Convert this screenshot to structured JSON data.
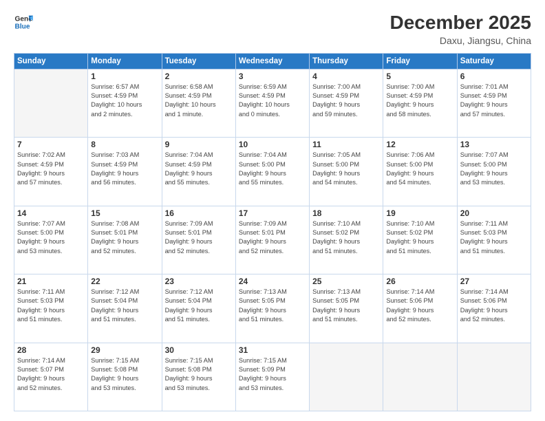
{
  "header": {
    "logo": {
      "line1": "General",
      "line2": "Blue"
    },
    "title": "December 2025",
    "location": "Daxu, Jiangsu, China"
  },
  "days_of_week": [
    "Sunday",
    "Monday",
    "Tuesday",
    "Wednesday",
    "Thursday",
    "Friday",
    "Saturday"
  ],
  "weeks": [
    [
      {
        "day": "",
        "info": ""
      },
      {
        "day": "1",
        "info": "Sunrise: 6:57 AM\nSunset: 4:59 PM\nDaylight: 10 hours\nand 2 minutes."
      },
      {
        "day": "2",
        "info": "Sunrise: 6:58 AM\nSunset: 4:59 PM\nDaylight: 10 hours\nand 1 minute."
      },
      {
        "day": "3",
        "info": "Sunrise: 6:59 AM\nSunset: 4:59 PM\nDaylight: 10 hours\nand 0 minutes."
      },
      {
        "day": "4",
        "info": "Sunrise: 7:00 AM\nSunset: 4:59 PM\nDaylight: 9 hours\nand 59 minutes."
      },
      {
        "day": "5",
        "info": "Sunrise: 7:00 AM\nSunset: 4:59 PM\nDaylight: 9 hours\nand 58 minutes."
      },
      {
        "day": "6",
        "info": "Sunrise: 7:01 AM\nSunset: 4:59 PM\nDaylight: 9 hours\nand 57 minutes."
      }
    ],
    [
      {
        "day": "7",
        "info": "Sunrise: 7:02 AM\nSunset: 4:59 PM\nDaylight: 9 hours\nand 57 minutes."
      },
      {
        "day": "8",
        "info": "Sunrise: 7:03 AM\nSunset: 4:59 PM\nDaylight: 9 hours\nand 56 minutes."
      },
      {
        "day": "9",
        "info": "Sunrise: 7:04 AM\nSunset: 4:59 PM\nDaylight: 9 hours\nand 55 minutes."
      },
      {
        "day": "10",
        "info": "Sunrise: 7:04 AM\nSunset: 5:00 PM\nDaylight: 9 hours\nand 55 minutes."
      },
      {
        "day": "11",
        "info": "Sunrise: 7:05 AM\nSunset: 5:00 PM\nDaylight: 9 hours\nand 54 minutes."
      },
      {
        "day": "12",
        "info": "Sunrise: 7:06 AM\nSunset: 5:00 PM\nDaylight: 9 hours\nand 54 minutes."
      },
      {
        "day": "13",
        "info": "Sunrise: 7:07 AM\nSunset: 5:00 PM\nDaylight: 9 hours\nand 53 minutes."
      }
    ],
    [
      {
        "day": "14",
        "info": "Sunrise: 7:07 AM\nSunset: 5:00 PM\nDaylight: 9 hours\nand 53 minutes."
      },
      {
        "day": "15",
        "info": "Sunrise: 7:08 AM\nSunset: 5:01 PM\nDaylight: 9 hours\nand 52 minutes."
      },
      {
        "day": "16",
        "info": "Sunrise: 7:09 AM\nSunset: 5:01 PM\nDaylight: 9 hours\nand 52 minutes."
      },
      {
        "day": "17",
        "info": "Sunrise: 7:09 AM\nSunset: 5:01 PM\nDaylight: 9 hours\nand 52 minutes."
      },
      {
        "day": "18",
        "info": "Sunrise: 7:10 AM\nSunset: 5:02 PM\nDaylight: 9 hours\nand 51 minutes."
      },
      {
        "day": "19",
        "info": "Sunrise: 7:10 AM\nSunset: 5:02 PM\nDaylight: 9 hours\nand 51 minutes."
      },
      {
        "day": "20",
        "info": "Sunrise: 7:11 AM\nSunset: 5:03 PM\nDaylight: 9 hours\nand 51 minutes."
      }
    ],
    [
      {
        "day": "21",
        "info": "Sunrise: 7:11 AM\nSunset: 5:03 PM\nDaylight: 9 hours\nand 51 minutes."
      },
      {
        "day": "22",
        "info": "Sunrise: 7:12 AM\nSunset: 5:04 PM\nDaylight: 9 hours\nand 51 minutes."
      },
      {
        "day": "23",
        "info": "Sunrise: 7:12 AM\nSunset: 5:04 PM\nDaylight: 9 hours\nand 51 minutes."
      },
      {
        "day": "24",
        "info": "Sunrise: 7:13 AM\nSunset: 5:05 PM\nDaylight: 9 hours\nand 51 minutes."
      },
      {
        "day": "25",
        "info": "Sunrise: 7:13 AM\nSunset: 5:05 PM\nDaylight: 9 hours\nand 51 minutes."
      },
      {
        "day": "26",
        "info": "Sunrise: 7:14 AM\nSunset: 5:06 PM\nDaylight: 9 hours\nand 52 minutes."
      },
      {
        "day": "27",
        "info": "Sunrise: 7:14 AM\nSunset: 5:06 PM\nDaylight: 9 hours\nand 52 minutes."
      }
    ],
    [
      {
        "day": "28",
        "info": "Sunrise: 7:14 AM\nSunset: 5:07 PM\nDaylight: 9 hours\nand 52 minutes."
      },
      {
        "day": "29",
        "info": "Sunrise: 7:15 AM\nSunset: 5:08 PM\nDaylight: 9 hours\nand 53 minutes."
      },
      {
        "day": "30",
        "info": "Sunrise: 7:15 AM\nSunset: 5:08 PM\nDaylight: 9 hours\nand 53 minutes."
      },
      {
        "day": "31",
        "info": "Sunrise: 7:15 AM\nSunset: 5:09 PM\nDaylight: 9 hours\nand 53 minutes."
      },
      {
        "day": "",
        "info": ""
      },
      {
        "day": "",
        "info": ""
      },
      {
        "day": "",
        "info": ""
      }
    ]
  ]
}
